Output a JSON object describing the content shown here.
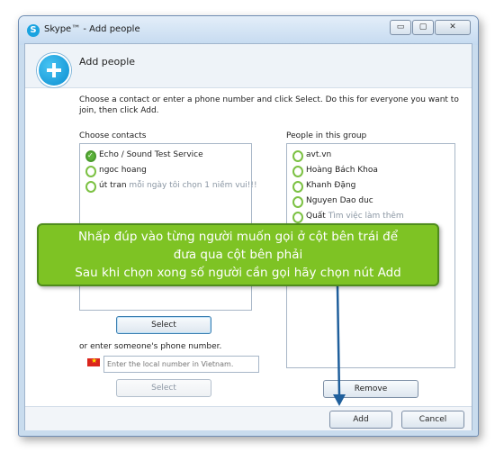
{
  "window": {
    "title": "Skype™ - Add people",
    "controls": {
      "minimize": "▭",
      "maximize": "▢",
      "close": "✕"
    }
  },
  "header": {
    "title": "Add people",
    "icon": "skype-add-icon"
  },
  "instruction": "Choose a contact or enter a phone number and click Select. Do this for everyone you want to join, then click Add.",
  "choose_contacts": {
    "label": "Choose contacts",
    "items": [
      {
        "name": "Echo / Sound Test Service",
        "mood": "",
        "icon": "check-status-icon"
      },
      {
        "name": "ngoc hoang",
        "mood": "",
        "icon": "offline-status-icon"
      },
      {
        "name": "út tran",
        "mood": "mỗi ngày tôi chọn 1 niềm vui!!!",
        "icon": "offline-status-icon"
      }
    ],
    "select_button": "Select"
  },
  "phone": {
    "label": "or enter someone's phone number.",
    "placeholder": "Enter the local number in Vietnam.",
    "flag": "vietnam-flag-icon",
    "select_button": "Select"
  },
  "people_in_group": {
    "label": "People in this group",
    "items": [
      {
        "name": "avt.vn",
        "mood": ""
      },
      {
        "name": "Hoàng Bách Khoa",
        "mood": ""
      },
      {
        "name": "Khanh Đặng",
        "mood": ""
      },
      {
        "name": "Nguyen Dao duc",
        "mood": ""
      },
      {
        "name": "Quất",
        "mood": "Tìm việc làm thêm"
      }
    ],
    "remove_button": "Remove"
  },
  "footer": {
    "add_button": "Add",
    "cancel_button": "Cancel"
  },
  "callout": {
    "lines": [
      "Nhấp đúp vào từng người muốn gọi ở cột bên trái để",
      "đưa qua cột bên phải",
      "Sau khi chọn xong số người cần gọi hãy chọn nút Add"
    ]
  },
  "colors": {
    "callout_bg": "#7ec324",
    "arrow": "#1f5f9c",
    "status_green": "#7cc143"
  }
}
